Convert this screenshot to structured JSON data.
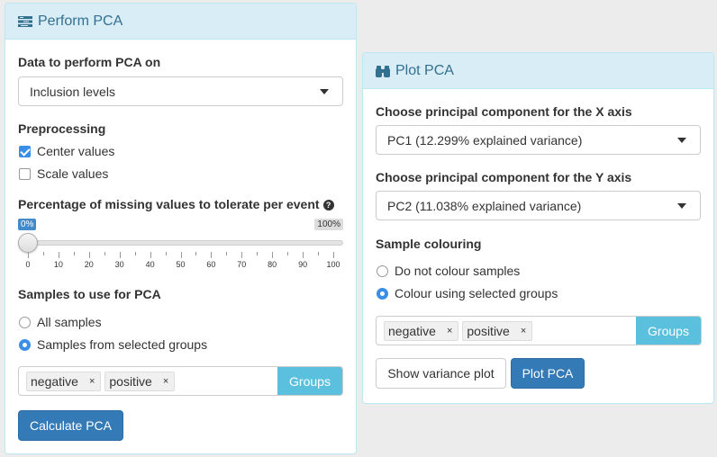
{
  "left_panel": {
    "title": "Perform PCA",
    "data_label": "Data to perform PCA on",
    "data_select_value": "Inclusion levels",
    "preprocessing_label": "Preprocessing",
    "center_values_label": "Center values",
    "center_values_checked": true,
    "scale_values_label": "Scale values",
    "scale_values_checked": false,
    "missing_label": "Percentage of missing values to tolerate per event",
    "slider": {
      "min_label": "0%",
      "max_label": "100%",
      "value_percent": 0,
      "ticks": [
        "0",
        "10",
        "20",
        "30",
        "40",
        "50",
        "60",
        "70",
        "80",
        "90",
        "100"
      ]
    },
    "samples_label": "Samples to use for PCA",
    "all_samples_label": "All samples",
    "selected_groups_label": "Samples from selected groups",
    "selected_option": "selected_groups",
    "groups": [
      "negative",
      "positive"
    ],
    "groups_button": "Groups",
    "calculate_button": "Calculate PCA"
  },
  "right_panel": {
    "title": "Plot PCA",
    "x_axis_label": "Choose principal component for the X axis",
    "x_axis_value": "PC1 (12.299% explained variance)",
    "y_axis_label": "Choose principal component for the Y axis",
    "y_axis_value": "PC2 (11.038% explained variance)",
    "colouring_label": "Sample colouring",
    "no_colour_label": "Do not colour samples",
    "colour_groups_label": "Colour using selected groups",
    "selected_option": "colour_groups",
    "groups": [
      "negative",
      "positive"
    ],
    "groups_button": "Groups",
    "variance_button": "Show variance plot",
    "plot_button": "Plot PCA"
  },
  "colors": {
    "heading_bg": "#d9edf7",
    "heading_text": "#31708f",
    "primary": "#337ab7",
    "info": "#5bc0de",
    "accent": "#3a8ee6"
  }
}
